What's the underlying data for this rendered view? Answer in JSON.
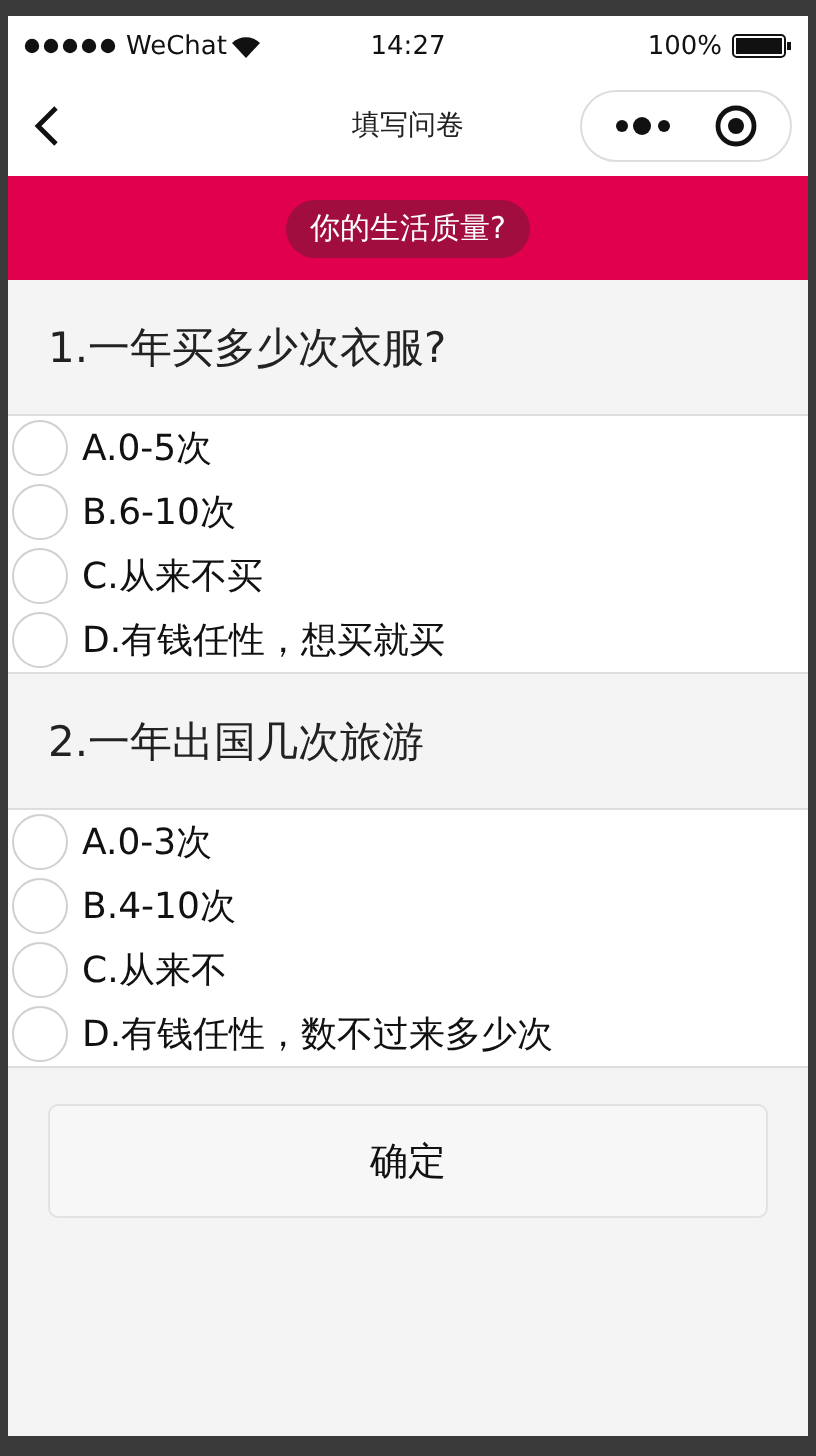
{
  "status_bar": {
    "carrier": "WeChat",
    "time": "14:27",
    "battery": "100%"
  },
  "nav_bar": {
    "title": "填写问卷"
  },
  "banner": {
    "title": "你的生活质量?"
  },
  "questions": [
    {
      "title": "1.一年买多少次衣服?",
      "options": [
        {
          "label": "A.0-5次",
          "selected": false
        },
        {
          "label": "B.6-10次",
          "selected": false
        },
        {
          "label": "C.从来不买",
          "selected": false
        },
        {
          "label": "D.有钱任性，想买就买",
          "selected": false
        }
      ]
    },
    {
      "title": "2.一年出国几次旅游",
      "options": [
        {
          "label": "A.0-3次",
          "selected": false
        },
        {
          "label": "B.4-10次",
          "selected": false
        },
        {
          "label": "C.从来不",
          "selected": false
        },
        {
          "label": "D.有钱任性，数不过来多少次",
          "selected": false
        }
      ]
    }
  ],
  "submit_button": "确定"
}
